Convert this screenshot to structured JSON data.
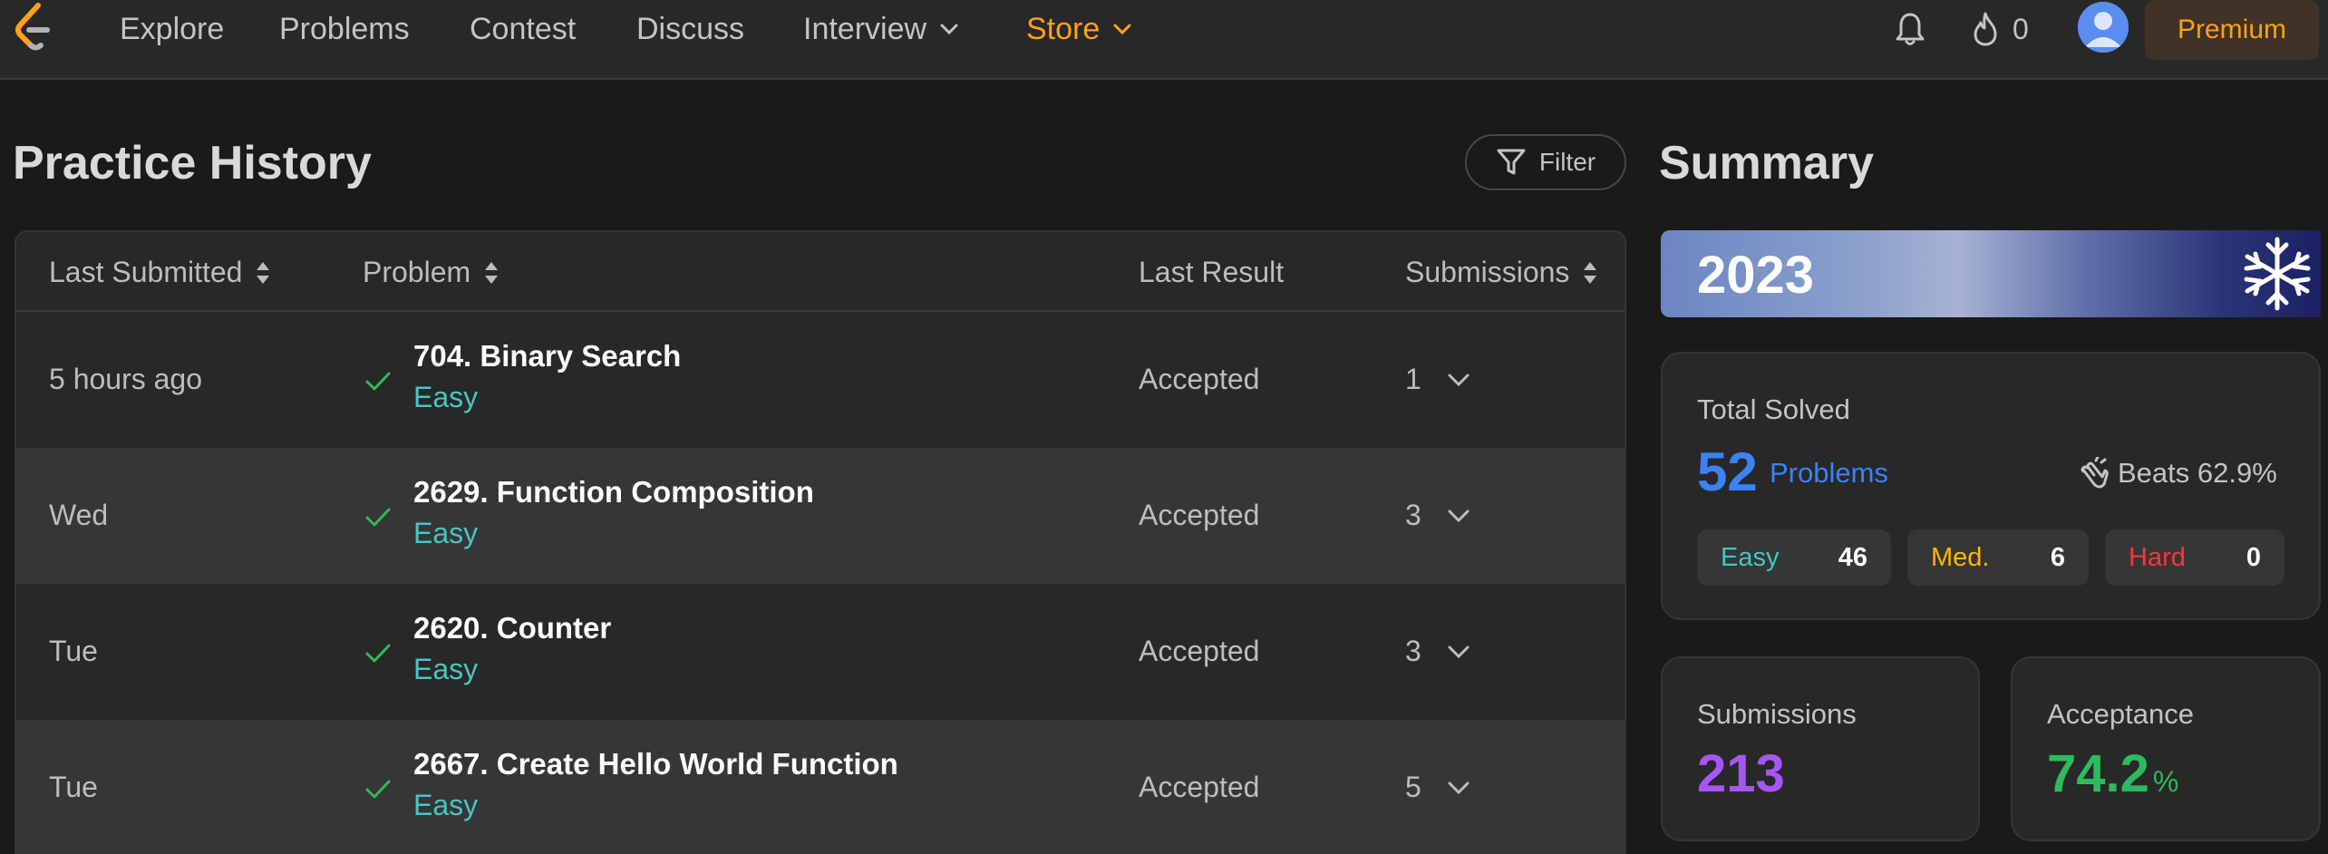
{
  "nav": {
    "links": [
      "Explore",
      "Problems",
      "Contest",
      "Discuss",
      "Interview",
      "Store"
    ],
    "streak_count": "0",
    "premium_label": "Premium"
  },
  "practice": {
    "title": "Practice History",
    "filter_label": "Filter",
    "columns": {
      "last_submitted": "Last Submitted",
      "problem": "Problem",
      "last_result": "Last Result",
      "submissions": "Submissions"
    },
    "rows": [
      {
        "when": "5 hours ago",
        "problem": "704. Binary Search",
        "difficulty": "Easy",
        "result": "Accepted",
        "submissions": "1"
      },
      {
        "when": "Wed",
        "problem": "2629. Function Composition",
        "difficulty": "Easy",
        "result": "Accepted",
        "submissions": "3"
      },
      {
        "when": "Tue",
        "problem": "2620. Counter",
        "difficulty": "Easy",
        "result": "Accepted",
        "submissions": "3"
      },
      {
        "when": "Tue",
        "problem": "2667. Create Hello World Function",
        "difficulty": "Easy",
        "result": "Accepted",
        "submissions": "5"
      }
    ]
  },
  "summary": {
    "title": "Summary",
    "year": "2023",
    "total_solved_label": "Total Solved",
    "total_solved": "52",
    "problems_label": "Problems",
    "beats": "Beats 62.9%",
    "easy_label": "Easy",
    "easy_count": "46",
    "medium_label": "Med.",
    "medium_count": "6",
    "hard_label": "Hard",
    "hard_count": "0",
    "submissions_label": "Submissions",
    "submissions_value": "213",
    "acceptance_label": "Acceptance",
    "acceptance_value": "74.2",
    "acceptance_unit": "%"
  },
  "colors": {
    "accent": "#ffa116",
    "easy": "#46c6c2",
    "medium": "#ffb800",
    "hard": "#f63737",
    "solved_blue": "#3b82f6",
    "submissions_purple": "#a855f7",
    "acceptance_green": "#2cbb5d"
  }
}
